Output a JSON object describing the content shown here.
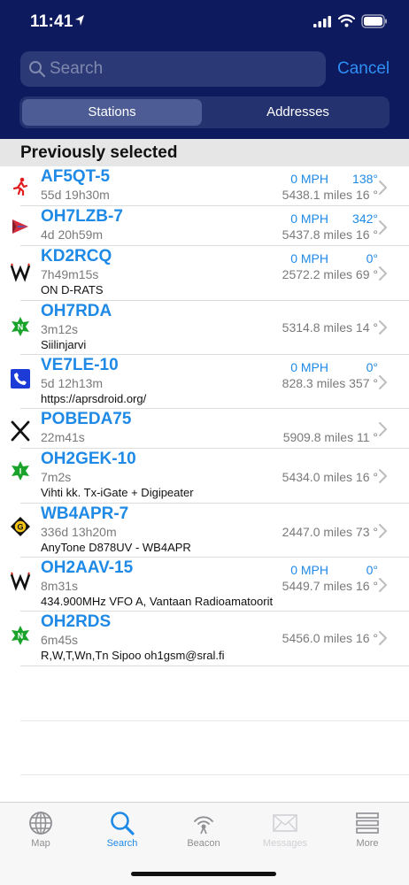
{
  "status_bar": {
    "time": "11:41"
  },
  "search": {
    "placeholder": "Search",
    "cancel_label": "Cancel"
  },
  "segments": {
    "stations": "Stations",
    "addresses": "Addresses",
    "selected": "Stations"
  },
  "section_title": "Previously selected",
  "stations": [
    {
      "callsign": "AF5QT-5",
      "age": "55d 19h30m",
      "comment": "",
      "speed": "0 MPH",
      "course": "138°",
      "distance": "5438.1 miles 16 °",
      "icon": "runner-icon"
    },
    {
      "callsign": "OH7LZB-7",
      "age": "4d 20h59m",
      "comment": "",
      "speed": "0 MPH",
      "course": "342°",
      "distance": "5437.8 miles 16 °",
      "icon": "aircraft-icon"
    },
    {
      "callsign": "KD2RCQ",
      "age": "7h49m15s",
      "comment": "ON D-RATS",
      "speed": "0 MPH",
      "course": "0°",
      "distance": "2572.2 miles 69 °",
      "icon": "weather-station-icon"
    },
    {
      "callsign": "OH7RDA",
      "age": "3m12s",
      "comment": "Siilinjarvi",
      "speed": "",
      "course": "",
      "distance": "5314.8 miles 14 °",
      "icon": "digipeater-n-icon"
    },
    {
      "callsign": "VE7LE-10",
      "age": "5d 12h13m",
      "comment": "https://aprsdroid.org/",
      "speed": "0 MPH",
      "course": "0°",
      "distance": "828.3 miles 357 °",
      "icon": "phone-icon"
    },
    {
      "callsign": "POBEDA75",
      "age": "22m41s",
      "comment": "",
      "speed": "",
      "course": "",
      "distance": "5909.8 miles 11 °",
      "icon": "x-mark-icon"
    },
    {
      "callsign": "OH2GEK-10",
      "age": "7m2s",
      "comment": "Vihti kk. Tx-iGate + Digipeater",
      "speed": "",
      "course": "",
      "distance": "5434.0 miles 16 °",
      "icon": "igate-i-icon"
    },
    {
      "callsign": "WB4APR-7",
      "age": "336d 13h20m",
      "comment": "AnyTone D878UV - WB4APR",
      "speed": "",
      "course": "",
      "distance": "2447.0 miles 73 °",
      "icon": "gateway-g-icon"
    },
    {
      "callsign": "OH2AAV-15",
      "age": "8m31s",
      "comment": "434.900MHz VFO A, Vantaan Radioamatoorit",
      "speed": "0 MPH",
      "course": "0°",
      "distance": "5449.7 miles 16 °",
      "icon": "weather-station-icon"
    },
    {
      "callsign": "OH2RDS",
      "age": "6m45s",
      "comment": "R,W,T,Wn,Tn Sipoo oh1gsm@sral.fi",
      "speed": "",
      "course": "",
      "distance": "5456.0 miles 16 °",
      "icon": "digipeater-n-icon"
    }
  ],
  "tabs": [
    {
      "label": "Map",
      "icon": "globe-icon",
      "state": "normal"
    },
    {
      "label": "Search",
      "icon": "search-icon",
      "state": "selected"
    },
    {
      "label": "Beacon",
      "icon": "beacon-icon",
      "state": "normal"
    },
    {
      "label": "Messages",
      "icon": "envelope-icon",
      "state": "disabled"
    },
    {
      "label": "More",
      "icon": "menu-icon",
      "state": "normal"
    }
  ],
  "colors": {
    "header_bg": "#0e1a5e",
    "accent": "#1f8ae6",
    "secondary_text": "#7a7a7a"
  }
}
